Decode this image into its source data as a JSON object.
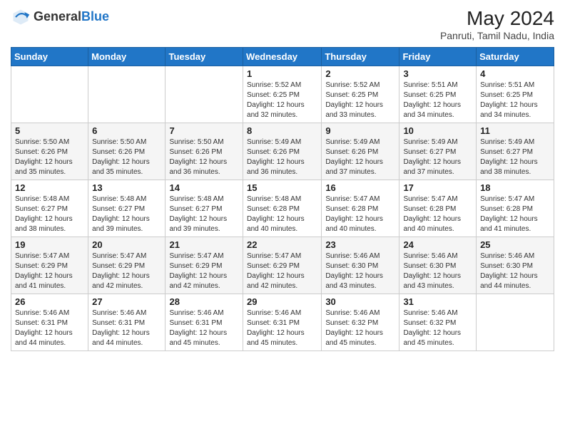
{
  "logo": {
    "general": "General",
    "blue": "Blue"
  },
  "title": {
    "month_year": "May 2024",
    "location": "Panruti, Tamil Nadu, India"
  },
  "days_of_week": [
    "Sunday",
    "Monday",
    "Tuesday",
    "Wednesday",
    "Thursday",
    "Friday",
    "Saturday"
  ],
  "weeks": [
    [
      {
        "day": "",
        "info": ""
      },
      {
        "day": "",
        "info": ""
      },
      {
        "day": "",
        "info": ""
      },
      {
        "day": "1",
        "info": "Sunrise: 5:52 AM\nSunset: 6:25 PM\nDaylight: 12 hours and 32 minutes."
      },
      {
        "day": "2",
        "info": "Sunrise: 5:52 AM\nSunset: 6:25 PM\nDaylight: 12 hours and 33 minutes."
      },
      {
        "day": "3",
        "info": "Sunrise: 5:51 AM\nSunset: 6:25 PM\nDaylight: 12 hours and 34 minutes."
      },
      {
        "day": "4",
        "info": "Sunrise: 5:51 AM\nSunset: 6:25 PM\nDaylight: 12 hours and 34 minutes."
      }
    ],
    [
      {
        "day": "5",
        "info": "Sunrise: 5:50 AM\nSunset: 6:26 PM\nDaylight: 12 hours and 35 minutes."
      },
      {
        "day": "6",
        "info": "Sunrise: 5:50 AM\nSunset: 6:26 PM\nDaylight: 12 hours and 35 minutes."
      },
      {
        "day": "7",
        "info": "Sunrise: 5:50 AM\nSunset: 6:26 PM\nDaylight: 12 hours and 36 minutes."
      },
      {
        "day": "8",
        "info": "Sunrise: 5:49 AM\nSunset: 6:26 PM\nDaylight: 12 hours and 36 minutes."
      },
      {
        "day": "9",
        "info": "Sunrise: 5:49 AM\nSunset: 6:26 PM\nDaylight: 12 hours and 37 minutes."
      },
      {
        "day": "10",
        "info": "Sunrise: 5:49 AM\nSunset: 6:27 PM\nDaylight: 12 hours and 37 minutes."
      },
      {
        "day": "11",
        "info": "Sunrise: 5:49 AM\nSunset: 6:27 PM\nDaylight: 12 hours and 38 minutes."
      }
    ],
    [
      {
        "day": "12",
        "info": "Sunrise: 5:48 AM\nSunset: 6:27 PM\nDaylight: 12 hours and 38 minutes."
      },
      {
        "day": "13",
        "info": "Sunrise: 5:48 AM\nSunset: 6:27 PM\nDaylight: 12 hours and 39 minutes."
      },
      {
        "day": "14",
        "info": "Sunrise: 5:48 AM\nSunset: 6:27 PM\nDaylight: 12 hours and 39 minutes."
      },
      {
        "day": "15",
        "info": "Sunrise: 5:48 AM\nSunset: 6:28 PM\nDaylight: 12 hours and 40 minutes."
      },
      {
        "day": "16",
        "info": "Sunrise: 5:47 AM\nSunset: 6:28 PM\nDaylight: 12 hours and 40 minutes."
      },
      {
        "day": "17",
        "info": "Sunrise: 5:47 AM\nSunset: 6:28 PM\nDaylight: 12 hours and 40 minutes."
      },
      {
        "day": "18",
        "info": "Sunrise: 5:47 AM\nSunset: 6:28 PM\nDaylight: 12 hours and 41 minutes."
      }
    ],
    [
      {
        "day": "19",
        "info": "Sunrise: 5:47 AM\nSunset: 6:29 PM\nDaylight: 12 hours and 41 minutes."
      },
      {
        "day": "20",
        "info": "Sunrise: 5:47 AM\nSunset: 6:29 PM\nDaylight: 12 hours and 42 minutes."
      },
      {
        "day": "21",
        "info": "Sunrise: 5:47 AM\nSunset: 6:29 PM\nDaylight: 12 hours and 42 minutes."
      },
      {
        "day": "22",
        "info": "Sunrise: 5:47 AM\nSunset: 6:29 PM\nDaylight: 12 hours and 42 minutes."
      },
      {
        "day": "23",
        "info": "Sunrise: 5:46 AM\nSunset: 6:30 PM\nDaylight: 12 hours and 43 minutes."
      },
      {
        "day": "24",
        "info": "Sunrise: 5:46 AM\nSunset: 6:30 PM\nDaylight: 12 hours and 43 minutes."
      },
      {
        "day": "25",
        "info": "Sunrise: 5:46 AM\nSunset: 6:30 PM\nDaylight: 12 hours and 44 minutes."
      }
    ],
    [
      {
        "day": "26",
        "info": "Sunrise: 5:46 AM\nSunset: 6:31 PM\nDaylight: 12 hours and 44 minutes."
      },
      {
        "day": "27",
        "info": "Sunrise: 5:46 AM\nSunset: 6:31 PM\nDaylight: 12 hours and 44 minutes."
      },
      {
        "day": "28",
        "info": "Sunrise: 5:46 AM\nSunset: 6:31 PM\nDaylight: 12 hours and 45 minutes."
      },
      {
        "day": "29",
        "info": "Sunrise: 5:46 AM\nSunset: 6:31 PM\nDaylight: 12 hours and 45 minutes."
      },
      {
        "day": "30",
        "info": "Sunrise: 5:46 AM\nSunset: 6:32 PM\nDaylight: 12 hours and 45 minutes."
      },
      {
        "day": "31",
        "info": "Sunrise: 5:46 AM\nSunset: 6:32 PM\nDaylight: 12 hours and 45 minutes."
      },
      {
        "day": "",
        "info": ""
      }
    ]
  ]
}
